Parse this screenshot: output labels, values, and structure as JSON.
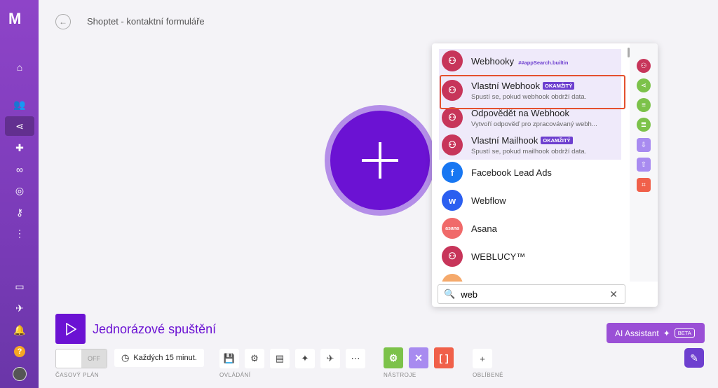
{
  "app": {
    "logo": "M"
  },
  "header": {
    "title": "Shoptet - kontaktní formuláře"
  },
  "sidebar": {
    "items": [
      {
        "name": "home",
        "glyph": "⌂"
      },
      {
        "name": "users",
        "glyph": "👥"
      },
      {
        "name": "scenarios",
        "glyph": "⋖"
      },
      {
        "name": "apps",
        "glyph": "✚"
      },
      {
        "name": "connections",
        "glyph": "∞"
      },
      {
        "name": "webhooks",
        "glyph": "◎"
      },
      {
        "name": "keys",
        "glyph": "⚷"
      },
      {
        "name": "more",
        "glyph": "⋮"
      },
      {
        "name": "docs",
        "glyph": "▭"
      },
      {
        "name": "rocket",
        "glyph": "✈"
      },
      {
        "name": "notifications",
        "glyph": "🔔"
      },
      {
        "name": "help",
        "glyph": "?"
      }
    ]
  },
  "module_panel": {
    "items": [
      {
        "name": "Webhooky",
        "tag": "##appSearch.builtin",
        "color": "#c7355a",
        "glyph": "⚇"
      },
      {
        "name": "Vlastní Webhook",
        "badge": "OKAMŽITÝ",
        "sub": "Spustí se, pokud webhook obdrží data.",
        "color": "#c7355a",
        "glyph": "⚇"
      },
      {
        "name": "Odpovědět na Webhook",
        "sub": "Vytvoří odpověď pro zpracovávaný webh...",
        "color": "#c7355a",
        "glyph": "⚇"
      },
      {
        "name": "Vlastní Mailhook",
        "badge": "OKAMŽITÝ",
        "sub": "Spustí se, pokud mailhook obdrží data.",
        "color": "#c7355a",
        "glyph": "⚇"
      },
      {
        "name": "Facebook Lead Ads",
        "color": "#1877f2",
        "glyph": "f"
      },
      {
        "name": "Webflow",
        "color": "#2b5ff0",
        "glyph": "w"
      },
      {
        "name": "Asana",
        "color": "#f06a6a",
        "glyph": "asana"
      },
      {
        "name": "WEBLUCY™",
        "color": "#c7355a",
        "glyph": "⚇"
      }
    ],
    "search": {
      "value": "web",
      "placeholder": ""
    }
  },
  "bottom": {
    "run_label": "Jednorázové spuštění",
    "toggle_off": "OFF",
    "schedule": "Každých 15 minut.",
    "labels": {
      "schedule": "ČASOVÝ PLÁN",
      "controls": "OVLÁDÁNÍ",
      "tools": "NÁSTROJE",
      "favorites": "OBLÍBENÉ"
    },
    "ai_label": "AI Assistant",
    "ai_badge": "BETA"
  },
  "colors": {
    "accent": "#6b12d3",
    "highlight": "#e4502e",
    "tool_green": "#7cc24a",
    "tool_purple": "#a88bf0",
    "tool_orange": "#f0604a"
  }
}
